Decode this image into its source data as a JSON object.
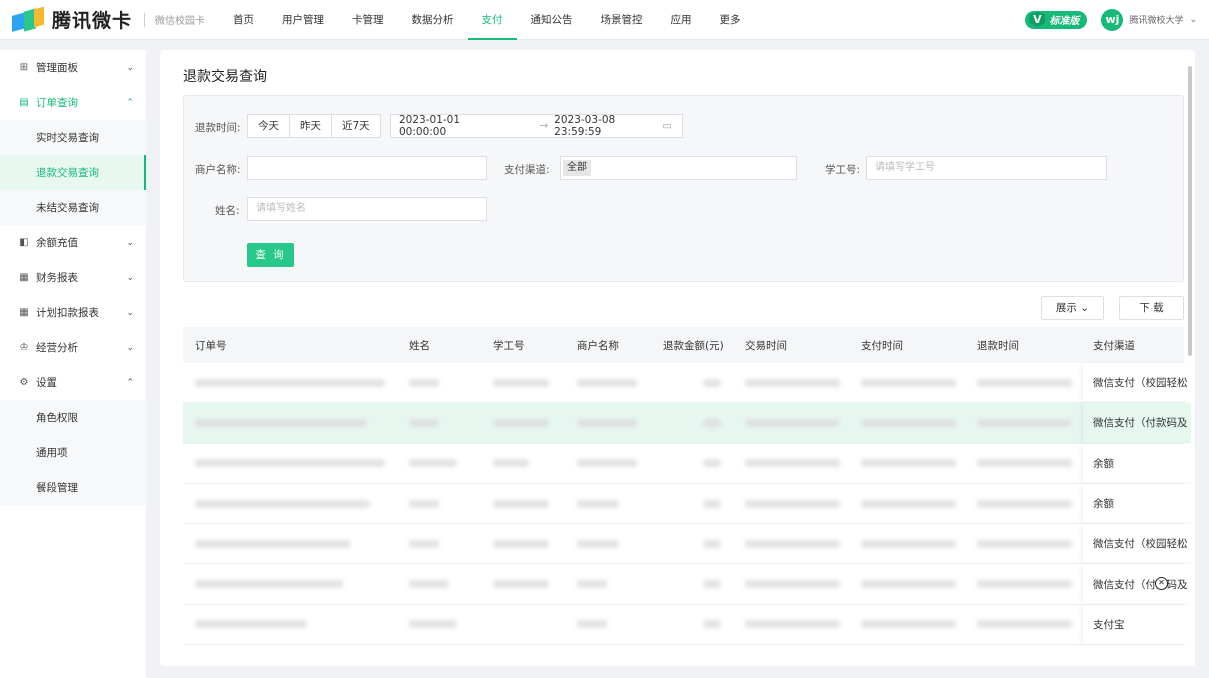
{
  "brand": {
    "name": "腾讯微卡",
    "sub": "微信校园卡"
  },
  "nav": [
    "首页",
    "用户管理",
    "卡管理",
    "数据分析",
    "支付",
    "通知公告",
    "场景管控",
    "应用",
    "更多"
  ],
  "nav_active": "支付",
  "version_badge": "标准版",
  "version_logo": "V",
  "user": {
    "avatar": "wj",
    "name": "腾讯微校大学"
  },
  "sidebar": {
    "items": [
      {
        "label": "管理面板",
        "icon": "dashboard-icon",
        "arrow": "⌄"
      },
      {
        "label": "订单查询",
        "icon": "order-icon",
        "arrow": "⌃"
      },
      {
        "label": "余额充值",
        "icon": "recharge-icon",
        "arrow": "⌄"
      },
      {
        "label": "财务报表",
        "icon": "report-icon",
        "arrow": "⌄"
      },
      {
        "label": "计划扣款报表",
        "icon": "plan-icon",
        "arrow": "⌄"
      },
      {
        "label": "经营分析",
        "icon": "analysis-icon",
        "arrow": "⌄"
      },
      {
        "label": "设置",
        "icon": "gear-icon",
        "arrow": "⌃"
      }
    ],
    "order_subs": [
      "实时交易查询",
      "退款交易查询",
      "未结交易查询"
    ],
    "settings_subs": [
      "角色权限",
      "通用项",
      "餐段管理"
    ]
  },
  "page": {
    "title": "退款交易查询"
  },
  "filters": {
    "refund_time_label": "退款时间:",
    "quick": [
      "今天",
      "昨天",
      "近7天"
    ],
    "date_start": "2023-01-01 00:00:00",
    "date_arrow": "→",
    "date_end": "2023-03-08 23:59:59",
    "merchant_label": "商户名称:",
    "channel_label": "支付渠道:",
    "channel_value": "全部",
    "staff_label": "学工号:",
    "staff_placeholder": "请填写学工号",
    "name_label": "姓名:",
    "name_placeholder": "请填写姓名",
    "search_button": "查 询"
  },
  "actions": {
    "display": "展示",
    "display_caret": "⌄",
    "download": "下 载"
  },
  "table": {
    "headers": [
      "订单号",
      "姓名",
      "学工号",
      "商户名称",
      "退款金额(元)",
      "交易时间",
      "支付时间",
      "退款时间",
      "支付渠道"
    ],
    "channels": [
      "微信支付（校园轻松",
      "微信支付（付款码及",
      "余额",
      "余额",
      "微信支付（校园轻松",
      "微信支付（付款码及",
      "支付宝"
    ]
  }
}
